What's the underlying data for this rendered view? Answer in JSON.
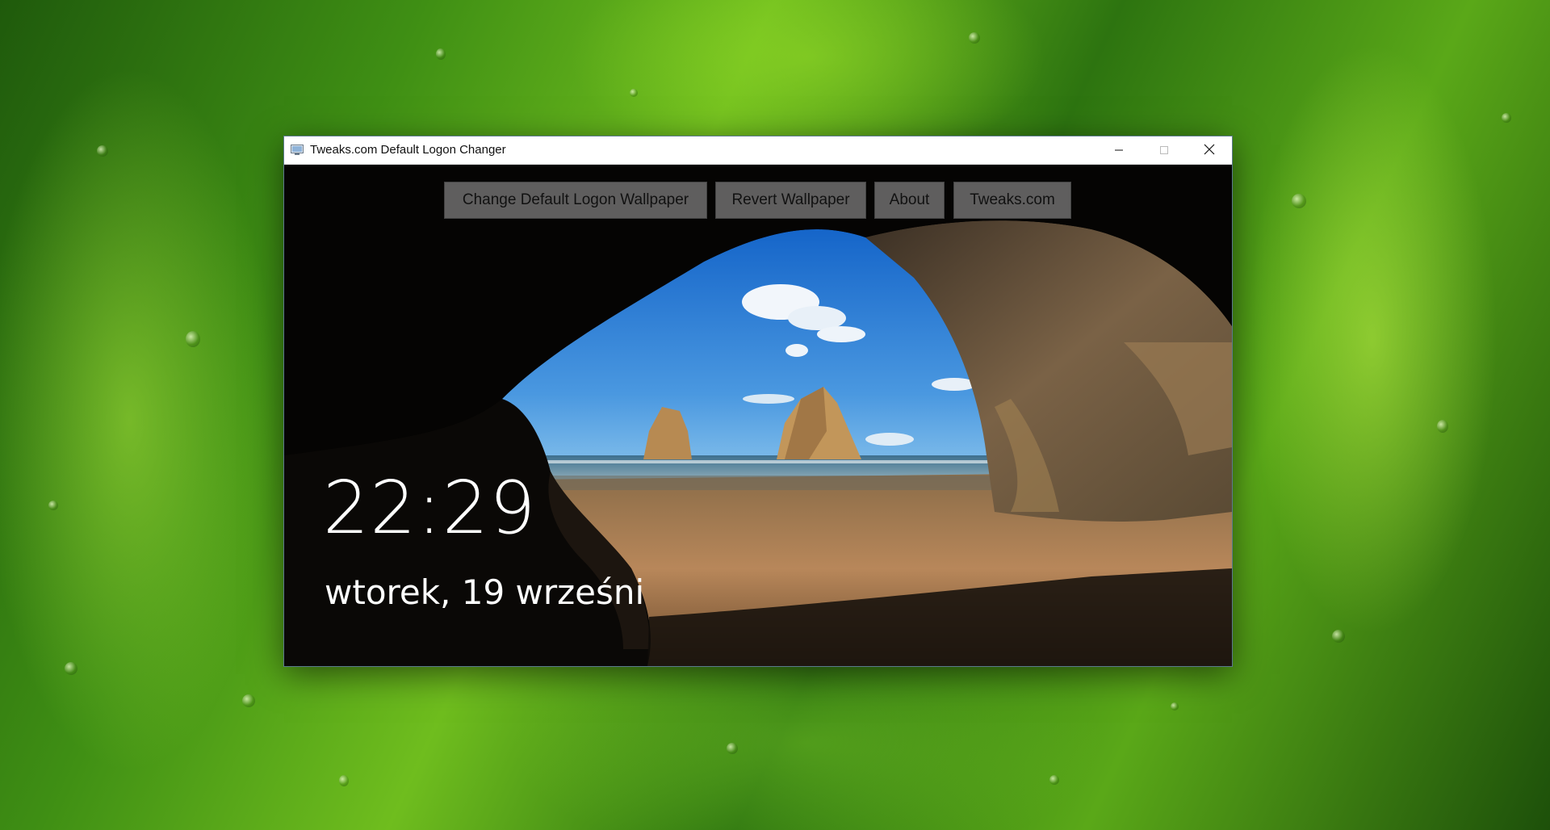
{
  "window": {
    "title": "Tweaks.com Default Logon Changer",
    "icon": "app-icon",
    "controls": {
      "minimize": "minimize-icon",
      "maximize": "maximize-icon",
      "close": "close-icon"
    }
  },
  "toolbar": {
    "buttons": [
      {
        "label": "Change Default Logon Wallpaper"
      },
      {
        "label": "Revert Wallpaper"
      },
      {
        "label": "About"
      },
      {
        "label": "Tweaks.com"
      }
    ]
  },
  "lockscreen": {
    "time": "22:29",
    "date": "wtorek, 19 wrześni"
  },
  "colors": {
    "button_bg": "#787878",
    "text_light": "#ffffff",
    "titlebar_bg": "#ffffff"
  }
}
